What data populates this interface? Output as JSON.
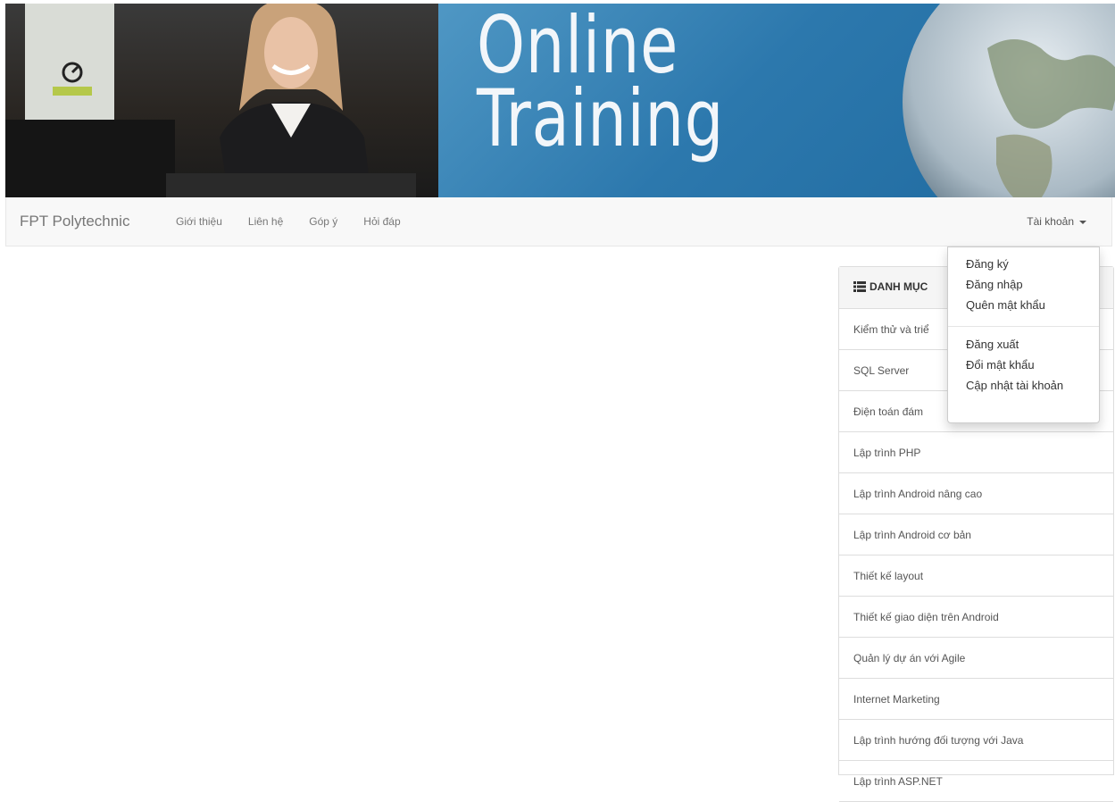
{
  "banner": {
    "title_line1": "Online",
    "title_line2": "Training"
  },
  "navbar": {
    "brand": "FPT Polytechnic",
    "links": [
      "Giới thiệu",
      "Liên hệ",
      "Góp ý",
      "Hỏi đáp"
    ],
    "account": "Tài khoản"
  },
  "dropdown": {
    "group1": [
      "Đăng ký",
      "Đăng nhập",
      "Quên mật khẩu"
    ],
    "group2": [
      "Đăng xuất",
      "Đổi mật khẩu",
      "Cập nhật tài khoản"
    ]
  },
  "categories": {
    "heading": "DANH MỤC",
    "items": [
      "Kiểm thử và triể",
      "SQL Server",
      "Điện toán đám",
      "Lập trình PHP",
      "Lập trình Android nâng cao",
      "Lập trình Android cơ bản",
      "Thiết kế layout",
      "Thiết kế giao diện trên Android",
      "Quản lý dự án với Agile",
      "Internet Marketing",
      "Lập trình hướng đối tượng với Java",
      "Lập trình ASP.NET"
    ]
  },
  "colors": {
    "banner_blue": "#2c78ad",
    "navbar_bg": "#f8f8f8",
    "panel_border": "#dddddd"
  },
  "icons": {
    "category": "list-icon",
    "account_caret": "caret-down-icon"
  }
}
